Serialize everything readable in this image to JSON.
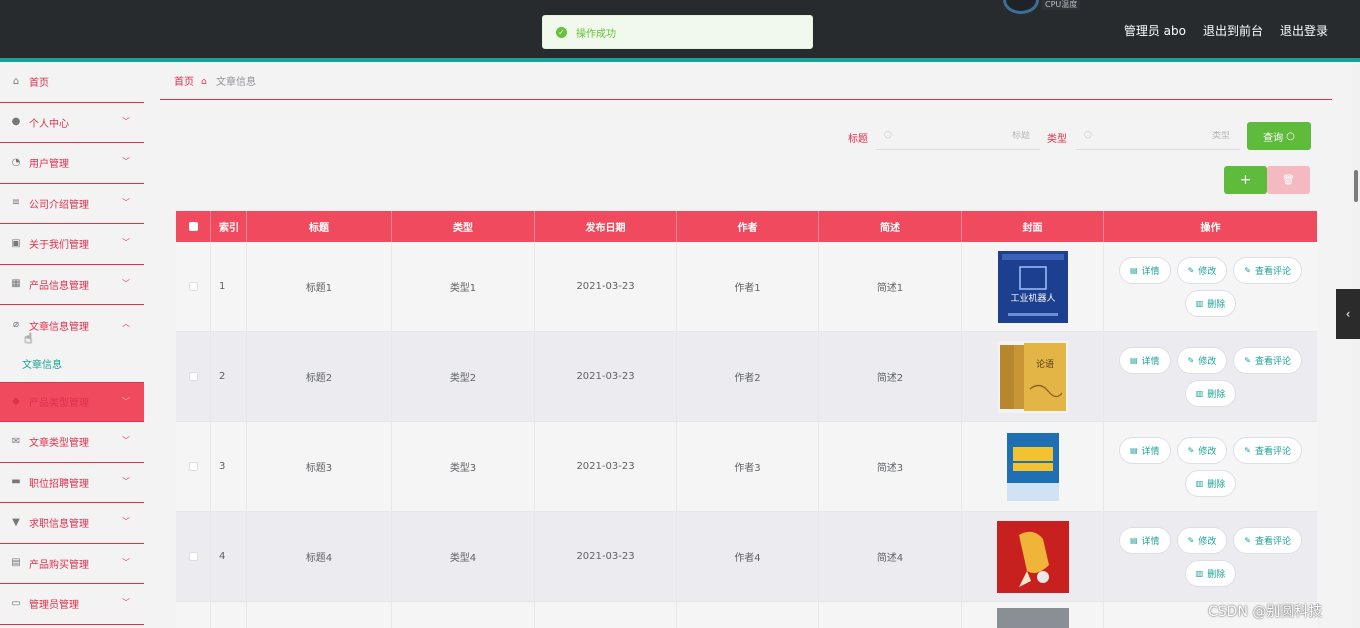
{
  "header": {
    "cpu_label": "CPU温度",
    "admin_label": "管理员 abo",
    "to_frontend": "退出到前台",
    "logout": "退出登录"
  },
  "toast": {
    "message": "操作成功"
  },
  "sidebar": {
    "items": [
      {
        "label": "首页",
        "icon": "home-icon"
      },
      {
        "label": "个人中心",
        "icon": "user-icon"
      },
      {
        "label": "用户管理",
        "icon": "gauge-icon"
      },
      {
        "label": "公司介绍管理",
        "icon": "list-icon"
      },
      {
        "label": "关于我们管理",
        "icon": "chart-icon"
      },
      {
        "label": "产品信息管理",
        "icon": "grid-icon"
      },
      {
        "label": "文章信息管理",
        "icon": "bell-off-icon"
      },
      {
        "label": "产品类型管理",
        "icon": "tag-icon"
      },
      {
        "label": "文章类型管理",
        "icon": "mail-icon"
      },
      {
        "label": "职位招聘管理",
        "icon": "monitor-icon"
      },
      {
        "label": "求职信息管理",
        "icon": "stamp-icon"
      },
      {
        "label": "产品购买管理",
        "icon": "clipboard-icon"
      },
      {
        "label": "管理员管理",
        "icon": "chat-icon"
      }
    ],
    "submenu": "文章信息"
  },
  "breadcrumb": {
    "home": "首页",
    "current": "文章信息"
  },
  "search": {
    "title_label": "标题",
    "title_placeholder": "标题",
    "type_label": "类型",
    "type_placeholder": "类型",
    "search_button": "查询",
    "add_button": "+"
  },
  "table": {
    "headers": {
      "index": "索引",
      "title": "标题",
      "type": "类型",
      "date": "发布日期",
      "author": "作者",
      "desc": "简述",
      "cover": "封面",
      "ops": "操作"
    },
    "rows": [
      {
        "index": "1",
        "title": "标题1",
        "type": "类型1",
        "date": "2021-03-23",
        "author": "作者1",
        "desc": "简述1",
        "cover_color": "#1d3f8f",
        "cover_text": "工业机器人"
      },
      {
        "index": "2",
        "title": "标题2",
        "type": "类型2",
        "date": "2021-03-23",
        "author": "作者2",
        "desc": "简述2",
        "cover_color": "#d8a93a",
        "cover_text": "论语"
      },
      {
        "index": "3",
        "title": "标题3",
        "type": "类型3",
        "date": "2021-03-23",
        "author": "作者3",
        "desc": "简述3",
        "cover_color": "#1f6fb5",
        "cover_text": ""
      },
      {
        "index": "4",
        "title": "标题4",
        "type": "类型4",
        "date": "2021-03-23",
        "author": "作者4",
        "desc": "简述4",
        "cover_color": "#c81f1f",
        "cover_text": ""
      }
    ],
    "ops": {
      "detail": "详情",
      "edit": "修改",
      "comments": "查看评论",
      "delete": "删除"
    }
  },
  "watermark": "CSDN @别圆科技"
}
